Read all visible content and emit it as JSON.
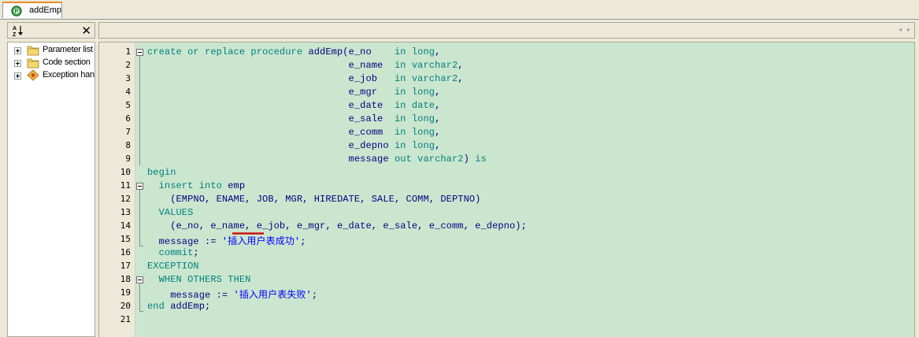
{
  "tab": {
    "label": "addEmp",
    "icon": "procedure-icon"
  },
  "left_panel": {
    "sort_icon": "sort-alpha-icon",
    "close_label": "✕",
    "tree": [
      {
        "label": "Parameter list",
        "icon": "folder-icon"
      },
      {
        "label": "Code section",
        "icon": "folder-icon"
      },
      {
        "label": "Exception handlers",
        "icon": "exception-icon"
      }
    ]
  },
  "scroll_arrows": {
    "left": "◂",
    "right": "▸"
  },
  "colors": {
    "editor_background": "#cbe6ce",
    "keyword": "#008080",
    "identifier": "#000080",
    "string": "#0000ff",
    "error_underline": "#cc0000",
    "active_tab_accent": "#e68b2c"
  },
  "editor": {
    "lines": [
      {
        "n": "1",
        "parts": [
          [
            "kw",
            "create or replace procedure "
          ],
          [
            "id",
            "addEmp(e_no    "
          ],
          [
            "kw",
            "in long"
          ],
          [
            "id",
            ","
          ]
        ]
      },
      {
        "n": "2",
        "parts": [
          [
            "id",
            "                                   e_name  "
          ],
          [
            "kw",
            "in varchar2"
          ],
          [
            "id",
            ","
          ]
        ]
      },
      {
        "n": "3",
        "parts": [
          [
            "id",
            "                                   e_job   "
          ],
          [
            "kw",
            "in varchar2"
          ],
          [
            "id",
            ","
          ]
        ]
      },
      {
        "n": "4",
        "parts": [
          [
            "id",
            "                                   e_mgr   "
          ],
          [
            "kw",
            "in long"
          ],
          [
            "id",
            ","
          ]
        ]
      },
      {
        "n": "5",
        "parts": [
          [
            "id",
            "                                   e_date  "
          ],
          [
            "kw",
            "in date"
          ],
          [
            "id",
            ","
          ]
        ]
      },
      {
        "n": "6",
        "parts": [
          [
            "id",
            "                                   e_sale  "
          ],
          [
            "kw",
            "in long"
          ],
          [
            "id",
            ","
          ]
        ]
      },
      {
        "n": "7",
        "parts": [
          [
            "id",
            "                                   e_comm  "
          ],
          [
            "kw",
            "in long"
          ],
          [
            "id",
            ","
          ]
        ]
      },
      {
        "n": "8",
        "parts": [
          [
            "id",
            "                                   e_depno "
          ],
          [
            "kw",
            "in long"
          ],
          [
            "id",
            ","
          ]
        ]
      },
      {
        "n": "9",
        "parts": [
          [
            "id",
            "                                   message "
          ],
          [
            "kw",
            "out varchar2"
          ],
          [
            "id",
            ") "
          ],
          [
            "kw",
            "is"
          ]
        ]
      },
      {
        "n": "10",
        "parts": [
          [
            "kw",
            "begin"
          ]
        ]
      },
      {
        "n": "11",
        "parts": [
          [
            "kw",
            "  insert into "
          ],
          [
            "id",
            "emp"
          ]
        ]
      },
      {
        "n": "12",
        "parts": [
          [
            "id",
            "    (EMPNO, ENAME, JOB, MGR, HIREDATE, SALE, COMM, DEPTNO)"
          ]
        ]
      },
      {
        "n": "13",
        "parts": [
          [
            "kw",
            "  VALUES"
          ]
        ]
      },
      {
        "n": "14",
        "parts": [
          [
            "id",
            "    (e_no, e_name, e_job, e_mgr, e_date, e_sale, e_comm, e_depno);"
          ]
        ]
      },
      {
        "n": "15",
        "parts": [
          [
            "id",
            "  message := "
          ],
          [
            "str",
            "'插入用户表成功'"
          ],
          [
            "id",
            ";"
          ]
        ]
      },
      {
        "n": "16",
        "parts": [
          [
            "kw",
            "  commit"
          ],
          [
            "id",
            ";"
          ]
        ]
      },
      {
        "n": "17",
        "parts": [
          [
            "kw",
            "EXCEPTION"
          ]
        ]
      },
      {
        "n": "18",
        "parts": [
          [
            "kw",
            "  WHEN OTHERS THEN"
          ]
        ]
      },
      {
        "n": "19",
        "parts": [
          [
            "id",
            "    message := "
          ],
          [
            "str",
            "'插入用户表失败'"
          ],
          [
            "id",
            ";"
          ]
        ]
      },
      {
        "n": "20",
        "parts": [
          [
            "kw",
            "end "
          ],
          [
            "id",
            "addEmp;"
          ]
        ]
      },
      {
        "n": "21",
        "parts": []
      }
    ],
    "fold_markers": [
      "1",
      "11",
      "18"
    ]
  }
}
